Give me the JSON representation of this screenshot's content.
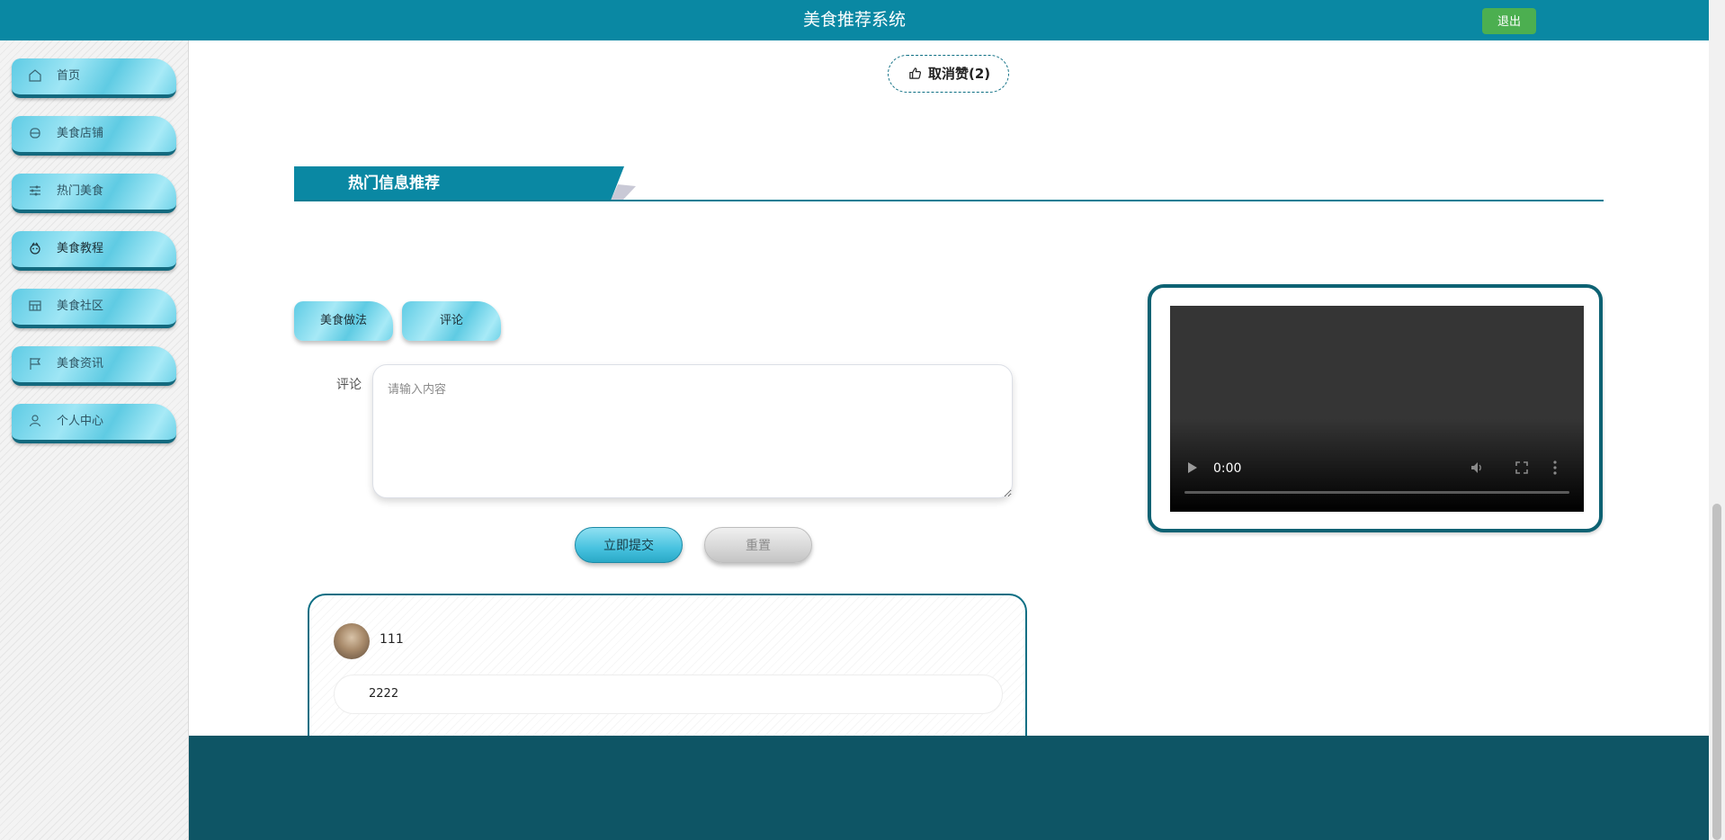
{
  "header": {
    "title": "美食推荐系统",
    "logout_label": "退出"
  },
  "sidebar": {
    "items": [
      {
        "label": "首页",
        "icon": "home-icon"
      },
      {
        "label": "美食店铺",
        "icon": "shop-icon"
      },
      {
        "label": "热门美食",
        "icon": "sliders-icon"
      },
      {
        "label": "美食教程",
        "icon": "tutorial-icon",
        "active": true
      },
      {
        "label": "美食社区",
        "icon": "community-icon"
      },
      {
        "label": "美食资讯",
        "icon": "flag-icon"
      },
      {
        "label": "个人中心",
        "icon": "user-icon"
      }
    ]
  },
  "like": {
    "label": "取消赞(2)",
    "icon": "thumbs-up-icon"
  },
  "section": {
    "title": "热门信息推荐"
  },
  "tabs": [
    {
      "label": "美食做法"
    },
    {
      "label": "评论",
      "active": true
    }
  ],
  "form": {
    "comment_label": "评论",
    "comment_placeholder": "请输入内容",
    "submit_label": "立即提交",
    "reset_label": "重置"
  },
  "comments": [
    {
      "username": "111",
      "text": "2222"
    }
  ],
  "video": {
    "time": "0:00"
  },
  "colors": {
    "primary": "#0a88a3",
    "footer": "#0e5565",
    "logout": "#4caf50",
    "accent": "#5ecbe4"
  }
}
